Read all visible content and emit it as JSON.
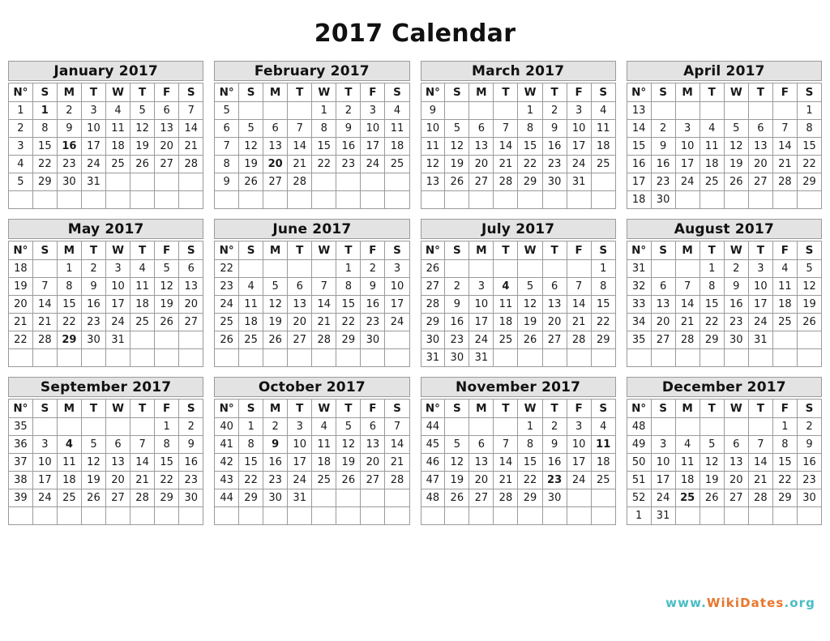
{
  "page": {
    "title": "2017 Calendar"
  },
  "footer": {
    "www": "www.",
    "name": "WikiDates",
    "tld": ".org"
  },
  "columns": {
    "week_number": "N°",
    "days": [
      "S",
      "M",
      "T",
      "W",
      "T",
      "F",
      "S"
    ]
  },
  "colors": {
    "sunday": "#e03a2f",
    "saturday": "#e8a719",
    "weekday": "#1a1a1a",
    "week_number": "#3434c4",
    "holiday": "#d8200f",
    "header_bg": "#e3e3e3",
    "border": "#9a9a9a",
    "footer_www": "#49bdc4",
    "footer_name": "#e8762c"
  },
  "months": [
    {
      "name": "January 2017",
      "weeks": [
        {
          "n": "1",
          "days": [
            "1",
            "2",
            "3",
            "4",
            "5",
            "6",
            "7"
          ],
          "holidays": [
            "1"
          ]
        },
        {
          "n": "2",
          "days": [
            "8",
            "9",
            "10",
            "11",
            "12",
            "13",
            "14"
          ],
          "holidays": []
        },
        {
          "n": "3",
          "days": [
            "15",
            "16",
            "17",
            "18",
            "19",
            "20",
            "21"
          ],
          "holidays": [
            "16"
          ]
        },
        {
          "n": "4",
          "days": [
            "22",
            "23",
            "24",
            "25",
            "26",
            "27",
            "28"
          ],
          "holidays": []
        },
        {
          "n": "5",
          "days": [
            "29",
            "30",
            "31",
            "",
            "",
            "",
            ""
          ],
          "holidays": []
        },
        {
          "n": "",
          "days": [
            "",
            "",
            "",
            "",
            "",
            "",
            ""
          ],
          "holidays": []
        }
      ]
    },
    {
      "name": "February 2017",
      "weeks": [
        {
          "n": "5",
          "days": [
            "",
            "",
            "",
            "1",
            "2",
            "3",
            "4"
          ],
          "holidays": []
        },
        {
          "n": "6",
          "days": [
            "5",
            "6",
            "7",
            "8",
            "9",
            "10",
            "11"
          ],
          "holidays": []
        },
        {
          "n": "7",
          "days": [
            "12",
            "13",
            "14",
            "15",
            "16",
            "17",
            "18"
          ],
          "holidays": []
        },
        {
          "n": "8",
          "days": [
            "19",
            "20",
            "21",
            "22",
            "23",
            "24",
            "25"
          ],
          "holidays": [
            "20"
          ]
        },
        {
          "n": "9",
          "days": [
            "26",
            "27",
            "28",
            "",
            "",
            "",
            ""
          ],
          "holidays": []
        },
        {
          "n": "",
          "days": [
            "",
            "",
            "",
            "",
            "",
            "",
            ""
          ],
          "holidays": []
        }
      ]
    },
    {
      "name": "March 2017",
      "weeks": [
        {
          "n": "9",
          "days": [
            "",
            "",
            "",
            "1",
            "2",
            "3",
            "4"
          ],
          "holidays": []
        },
        {
          "n": "10",
          "days": [
            "5",
            "6",
            "7",
            "8",
            "9",
            "10",
            "11"
          ],
          "holidays": []
        },
        {
          "n": "11",
          "days": [
            "12",
            "13",
            "14",
            "15",
            "16",
            "17",
            "18"
          ],
          "holidays": []
        },
        {
          "n": "12",
          "days": [
            "19",
            "20",
            "21",
            "22",
            "23",
            "24",
            "25"
          ],
          "holidays": []
        },
        {
          "n": "13",
          "days": [
            "26",
            "27",
            "28",
            "29",
            "30",
            "31",
            ""
          ],
          "holidays": []
        },
        {
          "n": "",
          "days": [
            "",
            "",
            "",
            "",
            "",
            "",
            ""
          ],
          "holidays": []
        }
      ]
    },
    {
      "name": "April 2017",
      "weeks": [
        {
          "n": "13",
          "days": [
            "",
            "",
            "",
            "",
            "",
            "",
            "1"
          ],
          "holidays": []
        },
        {
          "n": "14",
          "days": [
            "2",
            "3",
            "4",
            "5",
            "6",
            "7",
            "8"
          ],
          "holidays": []
        },
        {
          "n": "15",
          "days": [
            "9",
            "10",
            "11",
            "12",
            "13",
            "14",
            "15"
          ],
          "holidays": []
        },
        {
          "n": "16",
          "days": [
            "16",
            "17",
            "18",
            "19",
            "20",
            "21",
            "22"
          ],
          "holidays": []
        },
        {
          "n": "17",
          "days": [
            "23",
            "24",
            "25",
            "26",
            "27",
            "28",
            "29"
          ],
          "holidays": []
        },
        {
          "n": "18",
          "days": [
            "30",
            "",
            "",
            "",
            "",
            "",
            ""
          ],
          "holidays": []
        }
      ]
    },
    {
      "name": "May 2017",
      "weeks": [
        {
          "n": "18",
          "days": [
            "",
            "1",
            "2",
            "3",
            "4",
            "5",
            "6"
          ],
          "holidays": []
        },
        {
          "n": "19",
          "days": [
            "7",
            "8",
            "9",
            "10",
            "11",
            "12",
            "13"
          ],
          "holidays": []
        },
        {
          "n": "20",
          "days": [
            "14",
            "15",
            "16",
            "17",
            "18",
            "19",
            "20"
          ],
          "holidays": []
        },
        {
          "n": "21",
          "days": [
            "21",
            "22",
            "23",
            "24",
            "25",
            "26",
            "27"
          ],
          "holidays": []
        },
        {
          "n": "22",
          "days": [
            "28",
            "29",
            "30",
            "31",
            "",
            "",
            ""
          ],
          "holidays": [
            "29"
          ]
        },
        {
          "n": "",
          "days": [
            "",
            "",
            "",
            "",
            "",
            "",
            ""
          ],
          "holidays": []
        }
      ]
    },
    {
      "name": "June 2017",
      "weeks": [
        {
          "n": "22",
          "days": [
            "",
            "",
            "",
            "",
            "1",
            "2",
            "3"
          ],
          "holidays": []
        },
        {
          "n": "23",
          "days": [
            "4",
            "5",
            "6",
            "7",
            "8",
            "9",
            "10"
          ],
          "holidays": []
        },
        {
          "n": "24",
          "days": [
            "11",
            "12",
            "13",
            "14",
            "15",
            "16",
            "17"
          ],
          "holidays": []
        },
        {
          "n": "25",
          "days": [
            "18",
            "19",
            "20",
            "21",
            "22",
            "23",
            "24"
          ],
          "holidays": []
        },
        {
          "n": "26",
          "days": [
            "25",
            "26",
            "27",
            "28",
            "29",
            "30",
            ""
          ],
          "holidays": []
        },
        {
          "n": "",
          "days": [
            "",
            "",
            "",
            "",
            "",
            "",
            ""
          ],
          "holidays": []
        }
      ]
    },
    {
      "name": "July 2017",
      "weeks": [
        {
          "n": "26",
          "days": [
            "",
            "",
            "",
            "",
            "",
            "",
            "1"
          ],
          "holidays": []
        },
        {
          "n": "27",
          "days": [
            "2",
            "3",
            "4",
            "5",
            "6",
            "7",
            "8"
          ],
          "holidays": [
            "4"
          ]
        },
        {
          "n": "28",
          "days": [
            "9",
            "10",
            "11",
            "12",
            "13",
            "14",
            "15"
          ],
          "holidays": []
        },
        {
          "n": "29",
          "days": [
            "16",
            "17",
            "18",
            "19",
            "20",
            "21",
            "22"
          ],
          "holidays": []
        },
        {
          "n": "30",
          "days": [
            "23",
            "24",
            "25",
            "26",
            "27",
            "28",
            "29"
          ],
          "holidays": []
        },
        {
          "n": "31",
          "days": [
            "30",
            "31",
            "",
            "",
            "",
            "",
            ""
          ],
          "holidays": []
        }
      ]
    },
    {
      "name": "August 2017",
      "weeks": [
        {
          "n": "31",
          "days": [
            "",
            "",
            "1",
            "2",
            "3",
            "4",
            "5"
          ],
          "holidays": []
        },
        {
          "n": "32",
          "days": [
            "6",
            "7",
            "8",
            "9",
            "10",
            "11",
            "12"
          ],
          "holidays": []
        },
        {
          "n": "33",
          "days": [
            "13",
            "14",
            "15",
            "16",
            "17",
            "18",
            "19"
          ],
          "holidays": []
        },
        {
          "n": "34",
          "days": [
            "20",
            "21",
            "22",
            "23",
            "24",
            "25",
            "26"
          ],
          "holidays": []
        },
        {
          "n": "35",
          "days": [
            "27",
            "28",
            "29",
            "30",
            "31",
            "",
            ""
          ],
          "holidays": []
        },
        {
          "n": "",
          "days": [
            "",
            "",
            "",
            "",
            "",
            "",
            ""
          ],
          "holidays": []
        }
      ]
    },
    {
      "name": "September 2017",
      "weeks": [
        {
          "n": "35",
          "days": [
            "",
            "",
            "",
            "",
            "",
            "1",
            "2"
          ],
          "holidays": []
        },
        {
          "n": "36",
          "days": [
            "3",
            "4",
            "5",
            "6",
            "7",
            "8",
            "9"
          ],
          "holidays": [
            "4"
          ]
        },
        {
          "n": "37",
          "days": [
            "10",
            "11",
            "12",
            "13",
            "14",
            "15",
            "16"
          ],
          "holidays": []
        },
        {
          "n": "38",
          "days": [
            "17",
            "18",
            "19",
            "20",
            "21",
            "22",
            "23"
          ],
          "holidays": []
        },
        {
          "n": "39",
          "days": [
            "24",
            "25",
            "26",
            "27",
            "28",
            "29",
            "30"
          ],
          "holidays": []
        },
        {
          "n": "",
          "days": [
            "",
            "",
            "",
            "",
            "",
            "",
            ""
          ],
          "holidays": []
        }
      ]
    },
    {
      "name": "October 2017",
      "weeks": [
        {
          "n": "40",
          "days": [
            "1",
            "2",
            "3",
            "4",
            "5",
            "6",
            "7"
          ],
          "holidays": []
        },
        {
          "n": "41",
          "days": [
            "8",
            "9",
            "10",
            "11",
            "12",
            "13",
            "14"
          ],
          "holidays": [
            "9"
          ]
        },
        {
          "n": "42",
          "days": [
            "15",
            "16",
            "17",
            "18",
            "19",
            "20",
            "21"
          ],
          "holidays": []
        },
        {
          "n": "43",
          "days": [
            "22",
            "23",
            "24",
            "25",
            "26",
            "27",
            "28"
          ],
          "holidays": []
        },
        {
          "n": "44",
          "days": [
            "29",
            "30",
            "31",
            "",
            "",
            "",
            ""
          ],
          "holidays": []
        },
        {
          "n": "",
          "days": [
            "",
            "",
            "",
            "",
            "",
            "",
            ""
          ],
          "holidays": []
        }
      ]
    },
    {
      "name": "November 2017",
      "weeks": [
        {
          "n": "44",
          "days": [
            "",
            "",
            "",
            "1",
            "2",
            "3",
            "4"
          ],
          "holidays": []
        },
        {
          "n": "45",
          "days": [
            "5",
            "6",
            "7",
            "8",
            "9",
            "10",
            "11"
          ],
          "holidays": [
            "11"
          ]
        },
        {
          "n": "46",
          "days": [
            "12",
            "13",
            "14",
            "15",
            "16",
            "17",
            "18"
          ],
          "holidays": []
        },
        {
          "n": "47",
          "days": [
            "19",
            "20",
            "21",
            "22",
            "23",
            "24",
            "25"
          ],
          "holidays": [
            "23"
          ]
        },
        {
          "n": "48",
          "days": [
            "26",
            "27",
            "28",
            "29",
            "30",
            "",
            ""
          ],
          "holidays": []
        },
        {
          "n": "",
          "days": [
            "",
            "",
            "",
            "",
            "",
            "",
            ""
          ],
          "holidays": []
        }
      ]
    },
    {
      "name": "December 2017",
      "weeks": [
        {
          "n": "48",
          "days": [
            "",
            "",
            "",
            "",
            "",
            "1",
            "2"
          ],
          "holidays": []
        },
        {
          "n": "49",
          "days": [
            "3",
            "4",
            "5",
            "6",
            "7",
            "8",
            "9"
          ],
          "holidays": []
        },
        {
          "n": "50",
          "days": [
            "10",
            "11",
            "12",
            "13",
            "14",
            "15",
            "16"
          ],
          "holidays": []
        },
        {
          "n": "51",
          "days": [
            "17",
            "18",
            "19",
            "20",
            "21",
            "22",
            "23"
          ],
          "holidays": []
        },
        {
          "n": "52",
          "days": [
            "24",
            "25",
            "26",
            "27",
            "28",
            "29",
            "30"
          ],
          "holidays": [
            "25"
          ]
        },
        {
          "n": "1",
          "days": [
            "31",
            "",
            "",
            "",
            "",
            "",
            ""
          ],
          "holidays": []
        }
      ]
    }
  ]
}
